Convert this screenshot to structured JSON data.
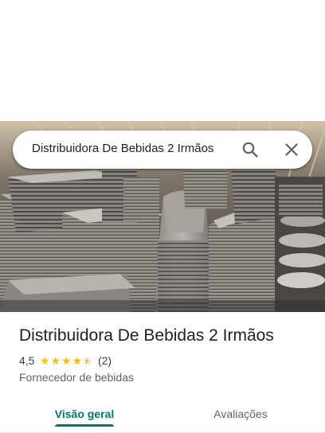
{
  "search": {
    "value": "Distribuidora De Bebidas 2 Irmãos",
    "search_icon": "search-icon",
    "close_icon": "close-icon"
  },
  "place": {
    "title": "Distribuidora De Bebidas 2 Irmãos",
    "rating": "4,5",
    "rating_value": 4.5,
    "review_count": "(2)",
    "category": "Fornecedor de bebidas"
  },
  "tabs": [
    {
      "label": "Visão geral",
      "active": true
    },
    {
      "label": "Avaliações",
      "active": false
    }
  ],
  "colors": {
    "accent": "#00796b",
    "star": "#fbbc04"
  }
}
